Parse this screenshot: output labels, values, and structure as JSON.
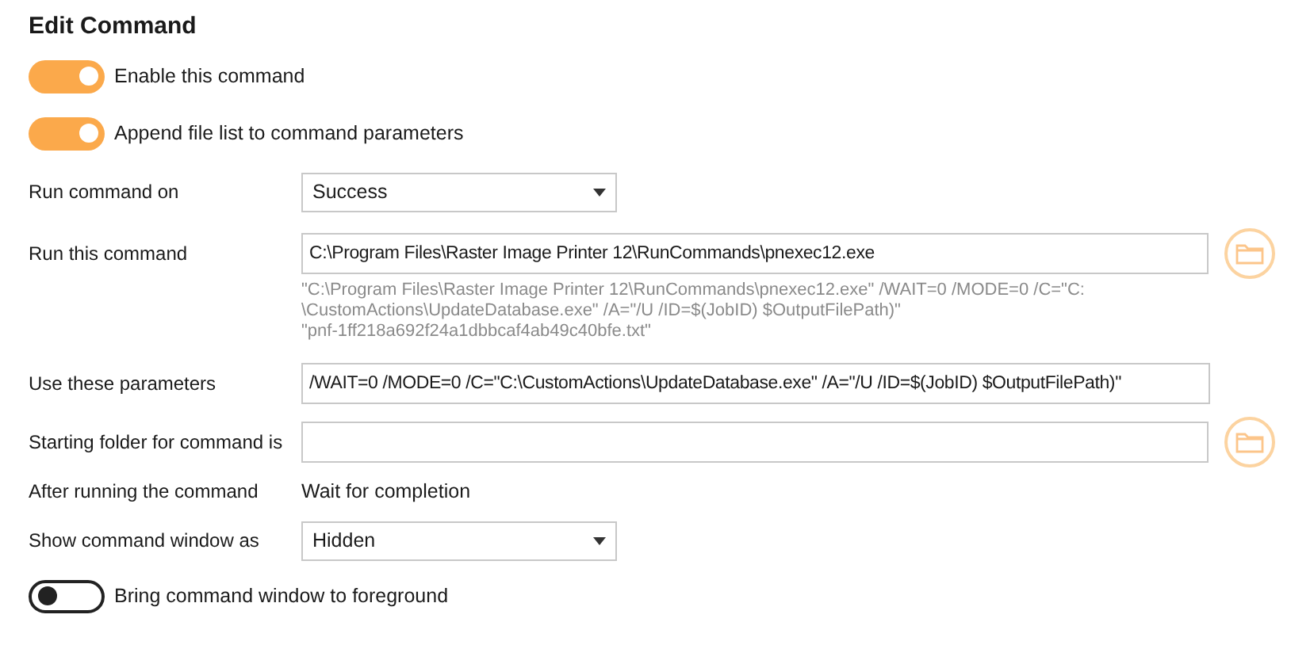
{
  "title": "Edit Command",
  "rows": [
    {
      "kind": "toggle",
      "label": "Enable this command",
      "on": true
    },
    {
      "kind": "toggle",
      "label": "Append file list to command parameters",
      "on": true
    },
    {
      "kind": "select",
      "label": "Run command on",
      "value": "Success"
    },
    {
      "kind": "input",
      "label": "Run this command",
      "value": "C:\\Program Files\\Raster Image Printer 12\\RunCommands\\pnexec12.exe",
      "browse": true
    },
    {
      "kind": "hint",
      "lines": [
        "\"C:\\Program Files\\Raster Image Printer 12\\RunCommands\\pnexec12.exe\" /WAIT=0 /MODE=0 /C=\"C:",
        "\\CustomActions\\UpdateDatabase.exe\" /A=\"/U /ID=$(JobID) $OutputFilePath)\"",
        "\"pnf-1ff218a692f24a1dbbcaf4ab49c40bfe.txt\""
      ]
    },
    {
      "kind": "input",
      "label": "Use these parameters",
      "value": "/WAIT=0 /MODE=0 /C=\"C:\\CustomActions\\UpdateDatabase.exe\" /A=\"/U /ID=$(JobID) $OutputFilePath)\"",
      "browse": false
    },
    {
      "kind": "input",
      "label": "Starting folder for command is",
      "value": "",
      "browse": true
    },
    {
      "kind": "text",
      "label": "After running the command",
      "value": "Wait for completion"
    },
    {
      "kind": "select",
      "label": "Show command window as",
      "value": "Hidden"
    },
    {
      "kind": "toggle",
      "label": "Bring command window to foreground",
      "on": false
    }
  ]
}
